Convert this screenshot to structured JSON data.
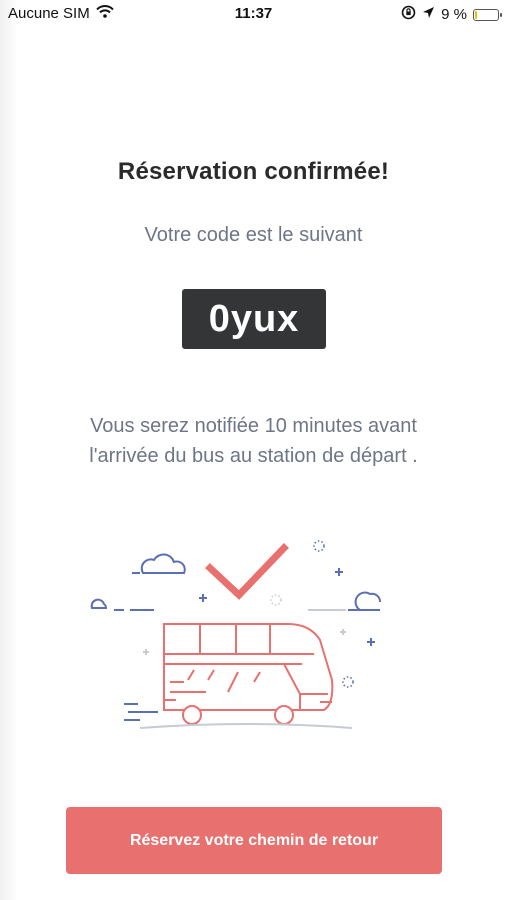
{
  "status_bar": {
    "carrier": "Aucune SIM",
    "time": "11:37",
    "battery_percent": "9 %",
    "battery_level": 0.09,
    "icons": [
      "wifi-icon",
      "screen-rotation-lock-icon",
      "location-arrow-icon",
      "battery-icon"
    ]
  },
  "confirmation": {
    "title": "Réservation confirmée!",
    "subtitle": "Votre code est le suivant",
    "code": "0yux",
    "note_line1": "Vous serez notifiée 10 minutes avant",
    "note_line2": "l'arrivée du bus au station de départ ."
  },
  "illustration": {
    "icon": "bus-confirmed-illustration",
    "colors": {
      "bus": "#e8706e",
      "accent": "#5b6fb5",
      "decor": "#c7cbd3"
    }
  },
  "actions": {
    "return_trip_label": "Réservez votre chemin de retour"
  },
  "colors": {
    "accent": "#e8706e",
    "code_background": "#333536",
    "text_dark": "#2b2b2b",
    "text_muted": "#6d7687"
  }
}
